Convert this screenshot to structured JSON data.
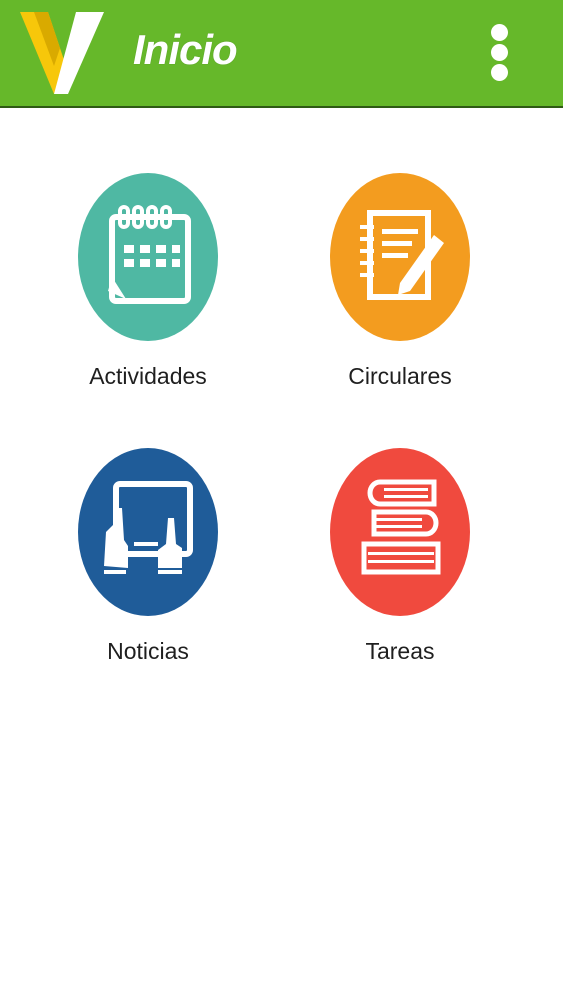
{
  "header": {
    "title": "Inicio",
    "background_color": "#66b82a",
    "logo_icon": "v-logo-icon",
    "menu_icon": "more-vert-icon"
  },
  "tiles": [
    {
      "label": "Actividades",
      "icon": "calendar-icon",
      "color": "#4fb8a3"
    },
    {
      "label": "Circulares",
      "icon": "notepad-pencil-icon",
      "color": "#f39c1f"
    },
    {
      "label": "Noticias",
      "icon": "touch-tablet-icon",
      "color": "#1f5c99"
    },
    {
      "label": "Tareas",
      "icon": "books-stack-icon",
      "color": "#f04a3e"
    }
  ]
}
